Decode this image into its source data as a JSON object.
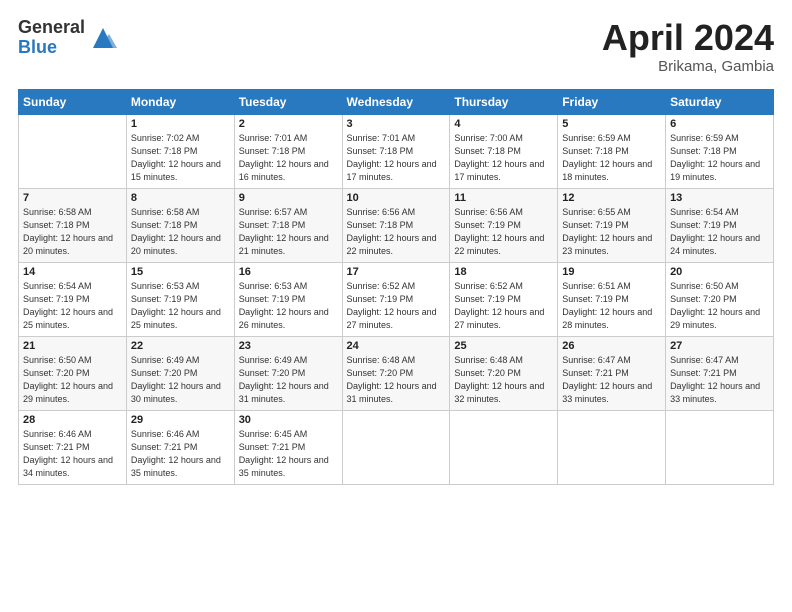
{
  "logo": {
    "general": "General",
    "blue": "Blue"
  },
  "title": {
    "month": "April 2024",
    "location": "Brikama, Gambia"
  },
  "header_days": [
    "Sunday",
    "Monday",
    "Tuesday",
    "Wednesday",
    "Thursday",
    "Friday",
    "Saturday"
  ],
  "weeks": [
    [
      {
        "day": "",
        "sunrise": "",
        "sunset": "",
        "daylight": ""
      },
      {
        "day": "1",
        "sunrise": "Sunrise: 7:02 AM",
        "sunset": "Sunset: 7:18 PM",
        "daylight": "Daylight: 12 hours and 15 minutes."
      },
      {
        "day": "2",
        "sunrise": "Sunrise: 7:01 AM",
        "sunset": "Sunset: 7:18 PM",
        "daylight": "Daylight: 12 hours and 16 minutes."
      },
      {
        "day": "3",
        "sunrise": "Sunrise: 7:01 AM",
        "sunset": "Sunset: 7:18 PM",
        "daylight": "Daylight: 12 hours and 17 minutes."
      },
      {
        "day": "4",
        "sunrise": "Sunrise: 7:00 AM",
        "sunset": "Sunset: 7:18 PM",
        "daylight": "Daylight: 12 hours and 17 minutes."
      },
      {
        "day": "5",
        "sunrise": "Sunrise: 6:59 AM",
        "sunset": "Sunset: 7:18 PM",
        "daylight": "Daylight: 12 hours and 18 minutes."
      },
      {
        "day": "6",
        "sunrise": "Sunrise: 6:59 AM",
        "sunset": "Sunset: 7:18 PM",
        "daylight": "Daylight: 12 hours and 19 minutes."
      }
    ],
    [
      {
        "day": "7",
        "sunrise": "Sunrise: 6:58 AM",
        "sunset": "Sunset: 7:18 PM",
        "daylight": "Daylight: 12 hours and 20 minutes."
      },
      {
        "day": "8",
        "sunrise": "Sunrise: 6:58 AM",
        "sunset": "Sunset: 7:18 PM",
        "daylight": "Daylight: 12 hours and 20 minutes."
      },
      {
        "day": "9",
        "sunrise": "Sunrise: 6:57 AM",
        "sunset": "Sunset: 7:18 PM",
        "daylight": "Daylight: 12 hours and 21 minutes."
      },
      {
        "day": "10",
        "sunrise": "Sunrise: 6:56 AM",
        "sunset": "Sunset: 7:18 PM",
        "daylight": "Daylight: 12 hours and 22 minutes."
      },
      {
        "day": "11",
        "sunrise": "Sunrise: 6:56 AM",
        "sunset": "Sunset: 7:19 PM",
        "daylight": "Daylight: 12 hours and 22 minutes."
      },
      {
        "day": "12",
        "sunrise": "Sunrise: 6:55 AM",
        "sunset": "Sunset: 7:19 PM",
        "daylight": "Daylight: 12 hours and 23 minutes."
      },
      {
        "day": "13",
        "sunrise": "Sunrise: 6:54 AM",
        "sunset": "Sunset: 7:19 PM",
        "daylight": "Daylight: 12 hours and 24 minutes."
      }
    ],
    [
      {
        "day": "14",
        "sunrise": "Sunrise: 6:54 AM",
        "sunset": "Sunset: 7:19 PM",
        "daylight": "Daylight: 12 hours and 25 minutes."
      },
      {
        "day": "15",
        "sunrise": "Sunrise: 6:53 AM",
        "sunset": "Sunset: 7:19 PM",
        "daylight": "Daylight: 12 hours and 25 minutes."
      },
      {
        "day": "16",
        "sunrise": "Sunrise: 6:53 AM",
        "sunset": "Sunset: 7:19 PM",
        "daylight": "Daylight: 12 hours and 26 minutes."
      },
      {
        "day": "17",
        "sunrise": "Sunrise: 6:52 AM",
        "sunset": "Sunset: 7:19 PM",
        "daylight": "Daylight: 12 hours and 27 minutes."
      },
      {
        "day": "18",
        "sunrise": "Sunrise: 6:52 AM",
        "sunset": "Sunset: 7:19 PM",
        "daylight": "Daylight: 12 hours and 27 minutes."
      },
      {
        "day": "19",
        "sunrise": "Sunrise: 6:51 AM",
        "sunset": "Sunset: 7:19 PM",
        "daylight": "Daylight: 12 hours and 28 minutes."
      },
      {
        "day": "20",
        "sunrise": "Sunrise: 6:50 AM",
        "sunset": "Sunset: 7:20 PM",
        "daylight": "Daylight: 12 hours and 29 minutes."
      }
    ],
    [
      {
        "day": "21",
        "sunrise": "Sunrise: 6:50 AM",
        "sunset": "Sunset: 7:20 PM",
        "daylight": "Daylight: 12 hours and 29 minutes."
      },
      {
        "day": "22",
        "sunrise": "Sunrise: 6:49 AM",
        "sunset": "Sunset: 7:20 PM",
        "daylight": "Daylight: 12 hours and 30 minutes."
      },
      {
        "day": "23",
        "sunrise": "Sunrise: 6:49 AM",
        "sunset": "Sunset: 7:20 PM",
        "daylight": "Daylight: 12 hours and 31 minutes."
      },
      {
        "day": "24",
        "sunrise": "Sunrise: 6:48 AM",
        "sunset": "Sunset: 7:20 PM",
        "daylight": "Daylight: 12 hours and 31 minutes."
      },
      {
        "day": "25",
        "sunrise": "Sunrise: 6:48 AM",
        "sunset": "Sunset: 7:20 PM",
        "daylight": "Daylight: 12 hours and 32 minutes."
      },
      {
        "day": "26",
        "sunrise": "Sunrise: 6:47 AM",
        "sunset": "Sunset: 7:21 PM",
        "daylight": "Daylight: 12 hours and 33 minutes."
      },
      {
        "day": "27",
        "sunrise": "Sunrise: 6:47 AM",
        "sunset": "Sunset: 7:21 PM",
        "daylight": "Daylight: 12 hours and 33 minutes."
      }
    ],
    [
      {
        "day": "28",
        "sunrise": "Sunrise: 6:46 AM",
        "sunset": "Sunset: 7:21 PM",
        "daylight": "Daylight: 12 hours and 34 minutes."
      },
      {
        "day": "29",
        "sunrise": "Sunrise: 6:46 AM",
        "sunset": "Sunset: 7:21 PM",
        "daylight": "Daylight: 12 hours and 35 minutes."
      },
      {
        "day": "30",
        "sunrise": "Sunrise: 6:45 AM",
        "sunset": "Sunset: 7:21 PM",
        "daylight": "Daylight: 12 hours and 35 minutes."
      },
      {
        "day": "",
        "sunrise": "",
        "sunset": "",
        "daylight": ""
      },
      {
        "day": "",
        "sunrise": "",
        "sunset": "",
        "daylight": ""
      },
      {
        "day": "",
        "sunrise": "",
        "sunset": "",
        "daylight": ""
      },
      {
        "day": "",
        "sunrise": "",
        "sunset": "",
        "daylight": ""
      }
    ]
  ]
}
